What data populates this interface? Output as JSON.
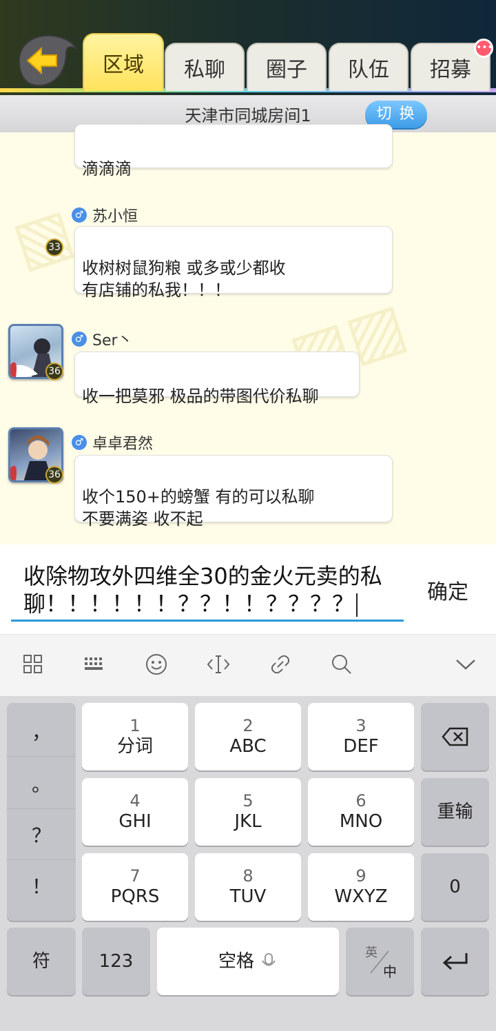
{
  "header": {
    "tabs": [
      {
        "label": "区域",
        "active": true
      },
      {
        "label": "私聊",
        "active": false
      },
      {
        "label": "圈子",
        "active": false
      },
      {
        "label": "队伍",
        "active": false
      },
      {
        "label": "招募",
        "active": false,
        "has_badge": true
      }
    ]
  },
  "room": {
    "name": "天津市同城房间1",
    "switch_label": "切 换"
  },
  "messages": [
    {
      "text": "滴滴滴"
    },
    {
      "sender": "苏小恒",
      "level": "33",
      "text": "收树树鼠狗粮 或多或少都收\n有店铺的私我！！！"
    },
    {
      "sender": "Ser丶",
      "level": "36",
      "text": "收一把莫邪  极品的带图代价私聊"
    },
    {
      "sender": "卓卓君然",
      "level": "36",
      "text": "收个150+的螃蟹 有的可以私聊\n不要满姿 收不起"
    }
  ],
  "input": {
    "value": "收除物攻外四维全30的金火元卖的私聊！！！！！！？？！！？？？？",
    "confirm_label": "确定"
  },
  "keyboard": {
    "toolbar_icons": [
      "grid-icon",
      "keyboard-icon",
      "emoji-icon",
      "cursor-icon",
      "link-icon",
      "search-icon",
      "collapse-icon"
    ],
    "punctuation": [
      "，",
      "。",
      "？",
      "！"
    ],
    "keys": [
      {
        "num": "1",
        "label": "分词"
      },
      {
        "num": "2",
        "label": "ABC"
      },
      {
        "num": "3",
        "label": "DEF"
      },
      {
        "num": "4",
        "label": "GHI"
      },
      {
        "num": "5",
        "label": "JKL"
      },
      {
        "num": "6",
        "label": "MNO"
      },
      {
        "num": "7",
        "label": "PQRS"
      },
      {
        "num": "8",
        "label": "TUV"
      },
      {
        "num": "9",
        "label": "WXYZ"
      }
    ],
    "reinput_label": "重输",
    "zero_label": "0",
    "symbols_label": "符",
    "numbers_label": "123",
    "space_label": "空格",
    "lang_top": "英",
    "lang_bottom": "中"
  },
  "colors": {
    "accent": "#2a9ad6",
    "tab_active": "#ffe35c",
    "chat_bg": "#fffde8"
  }
}
